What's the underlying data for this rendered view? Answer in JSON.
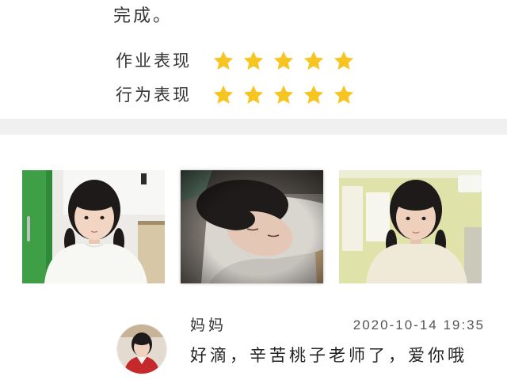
{
  "evaluation": {
    "text_tail": "完成。",
    "ratings": [
      {
        "label": "作业表现",
        "stars": 5,
        "max": 5,
        "icon": "star-icon"
      },
      {
        "label": "行为表现",
        "stars": 5,
        "max": 5,
        "icon": "star-icon"
      }
    ]
  },
  "comment": {
    "author": "妈妈",
    "timestamp": "2020-10-14 19:35",
    "text": "好滴，辛苦桃子老师了，爱你哦"
  },
  "colors": {
    "star": "#F7C521",
    "divider": "#F0F0F0"
  }
}
